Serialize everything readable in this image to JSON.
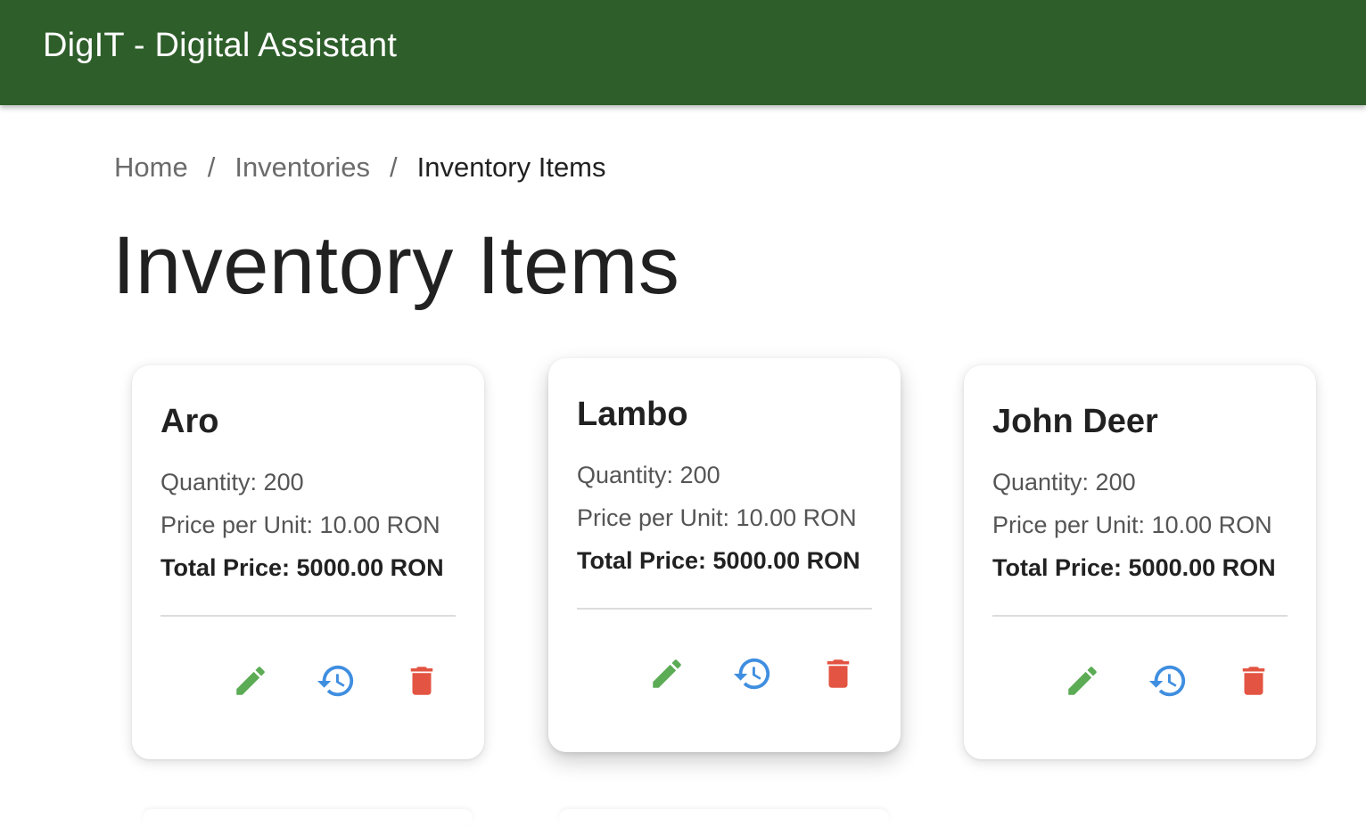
{
  "app": {
    "title": "DigIT - Digital Assistant"
  },
  "breadcrumb": {
    "items": [
      "Home",
      "Inventories",
      "Inventory Items"
    ],
    "separator": "/"
  },
  "page": {
    "heading": "Inventory Items"
  },
  "colors": {
    "appbar": "#2e5e2a",
    "edit_icon": "#5cab55",
    "history_icon": "#3f8ee0",
    "delete_icon": "#e35442"
  },
  "icons": {
    "edit": "pencil-icon",
    "history": "history-icon",
    "delete": "trash-icon"
  },
  "cards": [
    {
      "name": "Aro",
      "quantity": "Quantity: 200",
      "price_per_unit": "Price per Unit: 10.00 RON",
      "total_price": "Total Price: 5000.00 RON"
    },
    {
      "name": "Lambo",
      "quantity": "Quantity: 200",
      "price_per_unit": "Price per Unit: 10.00 RON",
      "total_price": "Total Price: 5000.00 RON"
    },
    {
      "name": "John Deer",
      "quantity": "Quantity: 200",
      "price_per_unit": "Price per Unit: 10.00 RON",
      "total_price": "Total Price: 5000.00 RON"
    }
  ]
}
